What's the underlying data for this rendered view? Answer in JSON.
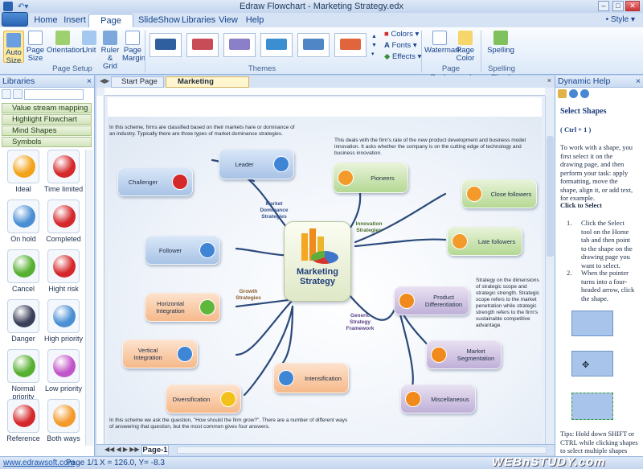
{
  "window": {
    "title": "Edraw Flowchart - Marketing Strategy.edx",
    "style_label": "Style"
  },
  "ribbon_tabs": [
    "Home",
    "Insert",
    "Page Layout",
    "SlideShow",
    "Libraries",
    "View",
    "Help"
  ],
  "page_setup": {
    "buttons": [
      "Auto Size",
      "Page Size",
      "Orientation",
      "Unit",
      "Ruler & Grid",
      "Page Margin"
    ],
    "group_label": "Page Setup"
  },
  "themes": {
    "group_label": "Themes",
    "colors_label": "Colors",
    "fonts_label": "Fonts",
    "effects_label": "Effects",
    "swatches": [
      "#2f5f9e",
      "#c84c58",
      "#8a7fc9",
      "#3b8fd0",
      "#4f86c6",
      "#e0643c"
    ]
  },
  "page_background": {
    "buttons": [
      "Watermark",
      "Page Color"
    ],
    "group_label": "Page Background"
  },
  "spelling": {
    "button": "Spelling",
    "group_label": "Spelling Check"
  },
  "libraries": {
    "title": "Libraries",
    "categories": [
      "Value stream mapping",
      "Highlight Flowchart Shapes",
      "Mind Shapes",
      "Symbols"
    ],
    "symbols": [
      {
        "label": "Ideal",
        "icon": "ideal-icon",
        "color": "#f3a31a"
      },
      {
        "label": "Time limited",
        "icon": "alarm-clock-icon",
        "color": "#d5282b"
      },
      {
        "label": "On hold",
        "icon": "gear-icon",
        "color": "#4a8fd3"
      },
      {
        "label": "Completed",
        "icon": "down-arrow-icon",
        "color": "#d5282b"
      },
      {
        "label": "Cancel",
        "icon": "cancel-x-icon",
        "color": "#57b030"
      },
      {
        "label": "Hight risk",
        "icon": "fire-extinguisher-icon",
        "color": "#d5282b"
      },
      {
        "label": "Danger",
        "icon": "bomb-icon",
        "color": "#3b3f5a"
      },
      {
        "label": "High priority",
        "icon": "up-arrow-icon",
        "color": "#4a8fd3"
      },
      {
        "label": "Normal priority",
        "icon": "right-arrow-icon",
        "color": "#57b030"
      },
      {
        "label": "Low priority",
        "icon": "down-arrow-icon",
        "color": "#c154c8"
      },
      {
        "label": "Reference",
        "icon": "red-circle-icon",
        "color": "#d5282b"
      },
      {
        "label": "Both ways",
        "icon": "orange-circle-icon",
        "color": "#f39a2a"
      }
    ]
  },
  "doc_tabs": [
    "Start Page",
    "Marketing Strategy.edx"
  ],
  "page_tab": "Page-1",
  "diagram": {
    "center": {
      "line1": "Marketing",
      "line2": "Strategy"
    },
    "intro_text": "In this scheme, firms are classified based on their markets hare or dominance of an industry. Typically there are three types of market dominance strategies.",
    "innovation_text": "This deals with the firm's rate of the new product development and business model innovation. It asks whether the company is on the cutting edge of technology and business innovation.",
    "generic_text": "Strategy on the dimensions of strategic scope and strategic strength. Strategic scope refers to the market penetration while strategic strength refers to the firm's sustainable competitive advantage.",
    "growth_text": "In this scheme we ask the question, \"How should the firm grow?\". There are a number of different ways of answering that question, but the most common gives four answers.",
    "branch_labels": {
      "market_dominance": "Market Dominance Strategies",
      "innovation": "Innovation Strategies",
      "growth": "Growth Strategies",
      "generic": "Generic Strategy Framework"
    },
    "nodes": {
      "leader": "Leader",
      "challenger": "Challenger",
      "follower": "Follower",
      "pioneers": "Pioneers",
      "close_followers": "Close followers",
      "late_followers": "Late followers",
      "product_differentiation": "Product Differentiation",
      "market_segmentation": "Market Segmentation",
      "miscellaneous": "Miscellaneous",
      "horizontal_integration": "Horizontal Integration",
      "vertical_integration": "Vertical Integration",
      "diversification": "Diversification",
      "intensification": "Intensification"
    }
  },
  "help": {
    "title": "Dynamic Help",
    "heading": "Select Shapes",
    "shortcut": "( Ctrl + 1 )",
    "intro": "To work with a shape, you first select it on the drawing page, and then perform your task: apply formatting, move the shape, align it, or add text, for example.",
    "click_heading": "Click to Select",
    "step1": "Click the Select tool on the Home tab and then point to the shape on the drawing page you want to select.",
    "step2": "When the pointer turns into a four-headed arrow, click the shape.",
    "tips": "Tips: Hold down SHIFT or CTRL while clicking shapes to select multiple shapes"
  },
  "status": {
    "link": "www.edrawsoft.com",
    "page": "Page 1/1",
    "coords": "X = 126.0, Y= -8.3",
    "watermark": "WEBnSTUDY.com"
  }
}
